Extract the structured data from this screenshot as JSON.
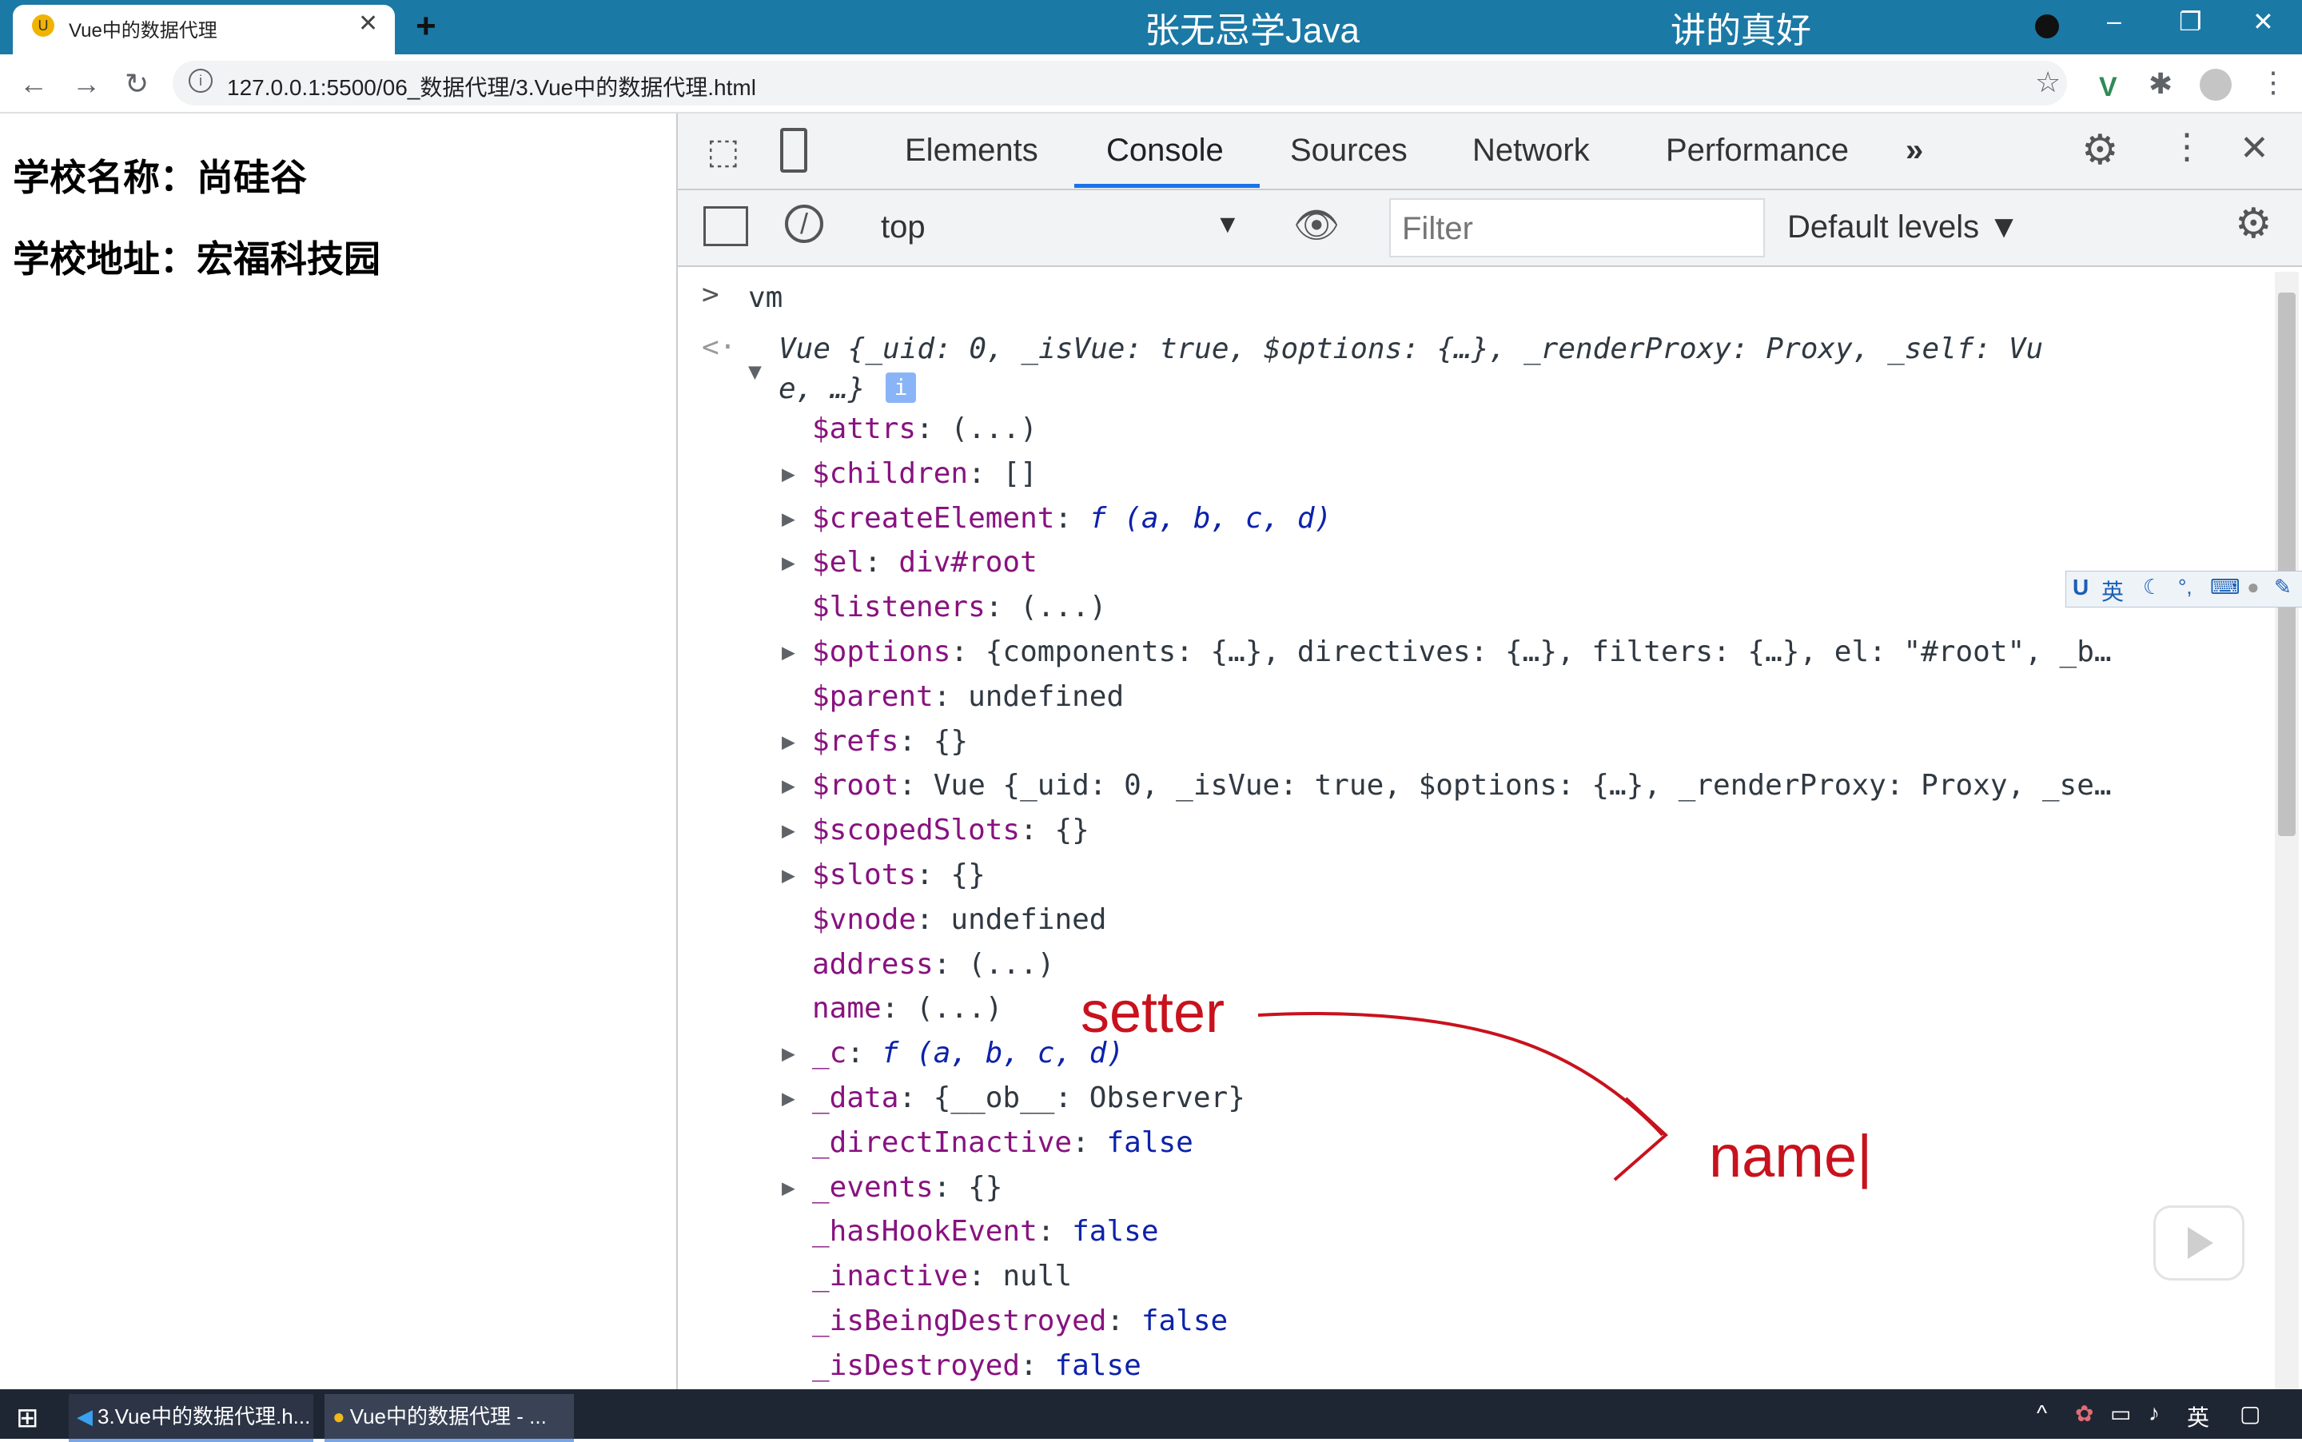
{
  "browser": {
    "tab_title": "Vue中的数据代理",
    "tab_close": "✕",
    "new_tab": "+",
    "overlay_left": "张无忌学Java",
    "overlay_right": "讲的真好",
    "url": "127.0.0.1:5500/06_数据代理/3.Vue中的数据代理.html",
    "icons": [
      "back-icon",
      "forward-icon",
      "reload-icon",
      "info-icon",
      "star-icon",
      "vue-devtools-icon",
      "extensions-icon",
      "profile-icon",
      "menu-icon",
      "minimize-icon",
      "restore-icon",
      "close-icon",
      "record-icon"
    ]
  },
  "page": {
    "school_name_line": "学校名称：尚硅谷",
    "school_address_line": "学校地址：宏福科技园"
  },
  "devtools": {
    "tabs": [
      "Elements",
      "Console",
      "Sources",
      "Network",
      "Performance"
    ],
    "more_tabs": "»",
    "context": "top",
    "filter_placeholder": "Filter",
    "levels": "Default levels ▼",
    "input_echo": "vm",
    "root_line1": "Vue {_uid: 0, _isVue: true, $options: {…}, _renderProxy: Proxy, _self: Vu",
    "root_line2": "e, …}",
    "info_badge": "i",
    "props": [
      {
        "expandable": false,
        "key": "$attrs",
        "value": "(...)",
        "vclass": ""
      },
      {
        "expandable": true,
        "key": "$children",
        "value": "[]",
        "vclass": ""
      },
      {
        "expandable": true,
        "key": "$createElement",
        "value": "f (a, b, c, d)",
        "vclass": "fn"
      },
      {
        "expandable": true,
        "key": "$el",
        "value": "div#root",
        "vclass": "key"
      },
      {
        "expandable": false,
        "key": "$listeners",
        "value": "(...)",
        "vclass": ""
      },
      {
        "expandable": true,
        "key": "$options",
        "value": "{components: {…}, directives: {…}, filters: {…}, el: \"#root\", _b…",
        "vclass": ""
      },
      {
        "expandable": false,
        "key": "$parent",
        "value": "undefined",
        "vclass": ""
      },
      {
        "expandable": true,
        "key": "$refs",
        "value": "{}",
        "vclass": ""
      },
      {
        "expandable": true,
        "key": "$root",
        "value": "Vue {_uid: 0, _isVue: true, $options: {…}, _renderProxy: Proxy, _se…",
        "vclass": ""
      },
      {
        "expandable": true,
        "key": "$scopedSlots",
        "value": "{}",
        "vclass": ""
      },
      {
        "expandable": true,
        "key": "$slots",
        "value": "{}",
        "vclass": ""
      },
      {
        "expandable": false,
        "key": "$vnode",
        "value": "undefined",
        "vclass": ""
      },
      {
        "expandable": false,
        "key": "address",
        "value": "(...)",
        "vclass": ""
      },
      {
        "expandable": false,
        "key": "name",
        "value": "(...)",
        "vclass": ""
      },
      {
        "expandable": true,
        "key": "_c",
        "value": "f (a, b, c, d)",
        "vclass": "fn"
      },
      {
        "expandable": true,
        "key": "_data",
        "value": "{__ob__: Observer}",
        "vclass": ""
      },
      {
        "expandable": false,
        "key": "_directInactive",
        "value": "false",
        "vclass": "kw"
      },
      {
        "expandable": true,
        "key": "_events",
        "value": "{}",
        "vclass": ""
      },
      {
        "expandable": false,
        "key": "_hasHookEvent",
        "value": "false",
        "vclass": "kw"
      },
      {
        "expandable": false,
        "key": "_inactive",
        "value": "null",
        "vclass": ""
      },
      {
        "expandable": false,
        "key": "_isBeingDestroyed",
        "value": "false",
        "vclass": "kw"
      },
      {
        "expandable": false,
        "key": "_isDestroyed",
        "value": "false",
        "vclass": "kw"
      }
    ]
  },
  "annotations": {
    "setter": "setter",
    "name": "name|",
    "color": "#c8121d"
  },
  "ime": {
    "label": "英"
  },
  "taskbar": {
    "item1": "3.Vue中的数据代理.h...",
    "item2": "Vue中的数据代理 - ...",
    "tray_lang": "英"
  }
}
